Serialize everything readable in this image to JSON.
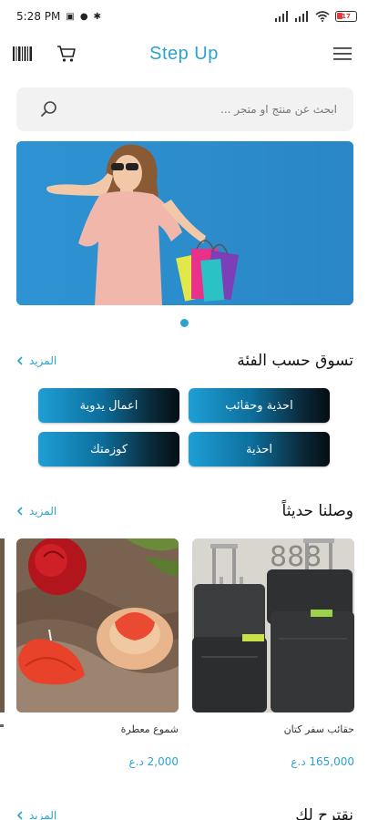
{
  "status_bar": {
    "time": "5:28 PM",
    "battery": "17"
  },
  "app_bar": {
    "title": "Step Up"
  },
  "search": {
    "placeholder": "ابحث عن منتج او متجر ..."
  },
  "banner": {
    "alt": "woman with shopping bags"
  },
  "carousel": {
    "count": 1,
    "active": 0
  },
  "categories_section": {
    "title": "تسوق حسب الفئة",
    "more": "المزيد",
    "items": [
      {
        "label": "اعمال يدوية"
      },
      {
        "label": "احذية وحقائب"
      },
      {
        "label": "كوزمتك"
      },
      {
        "label": "احذية"
      }
    ]
  },
  "new_arrivals_section": {
    "title": "وصلنا حديثاً",
    "more": "المزيد",
    "products": [
      {
        "name": "شموع معطرة",
        "price": "2,000 د.ع"
      },
      {
        "name": "حقائب سفر كتان",
        "price": "165,000 د.ع"
      }
    ]
  },
  "suggest_section": {
    "title": "نقترح لك",
    "more": "المزيد"
  },
  "colors": {
    "accent": "#2aa3cf",
    "category_gradient_start": "#1e9fd6",
    "category_gradient_end": "#050d12",
    "banner_bg": "#2c8fd0"
  },
  "icons": {
    "barcode": "barcode-icon",
    "cart": "cart-icon",
    "menu": "menu-icon",
    "search": "search-icon",
    "chevron": "chevron-left-icon"
  }
}
